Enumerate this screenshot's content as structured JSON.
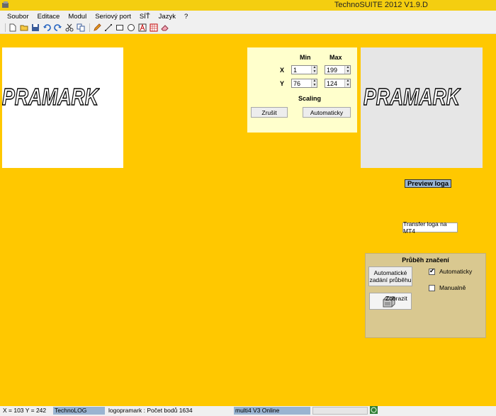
{
  "window": {
    "title": "TechnoSUITE 2012 V1.9.D"
  },
  "menu": [
    "Soubor",
    "Editace",
    "Modul",
    "Seriový port",
    "SÍŤ",
    "Jazyk",
    "?"
  ],
  "toolbar": {
    "icons": [
      "new-file-icon",
      "open-folder-icon",
      "save-icon",
      "undo-icon",
      "redo-icon",
      "cut-icon",
      "copy-icon",
      "pencil-icon",
      "line-icon",
      "rectangle-icon",
      "ellipse-icon",
      "text-icon",
      "grid-icon",
      "eraser-icon"
    ]
  },
  "logo": {
    "text": "PRAMARK"
  },
  "scaling": {
    "col_min": "Min",
    "col_max": "Max",
    "x_label": "X",
    "y_label": "Y",
    "x_min": "1",
    "x_max": "199",
    "y_min": "76",
    "y_max": "124",
    "section_label": "Scaling",
    "cancel_label": "Zrušit",
    "auto_label": "Automaticky"
  },
  "preview_button": "Preview loga",
  "transfer_button": "Transfer loga na MT4",
  "progress": {
    "title": "Průběh značení",
    "auto_button_line1": "Automatické",
    "auto_button_line2": "zadání průběhu",
    "show_button": "Zobrazit",
    "auto_check": "Automaticky",
    "auto_checked": true,
    "manual_check": "Manualně",
    "manual_checked": false
  },
  "status": {
    "coords": "X = 103 Y = 242",
    "module": "TechnoLOG",
    "info": "logopramark : Počet bodů 1634",
    "connection": "multi4 V3 Online"
  },
  "colors": {
    "background": "#FFC800",
    "accent": "#99B4D1",
    "scaling_bg": "#FFFFCC",
    "progress_bg": "#D9C890"
  }
}
